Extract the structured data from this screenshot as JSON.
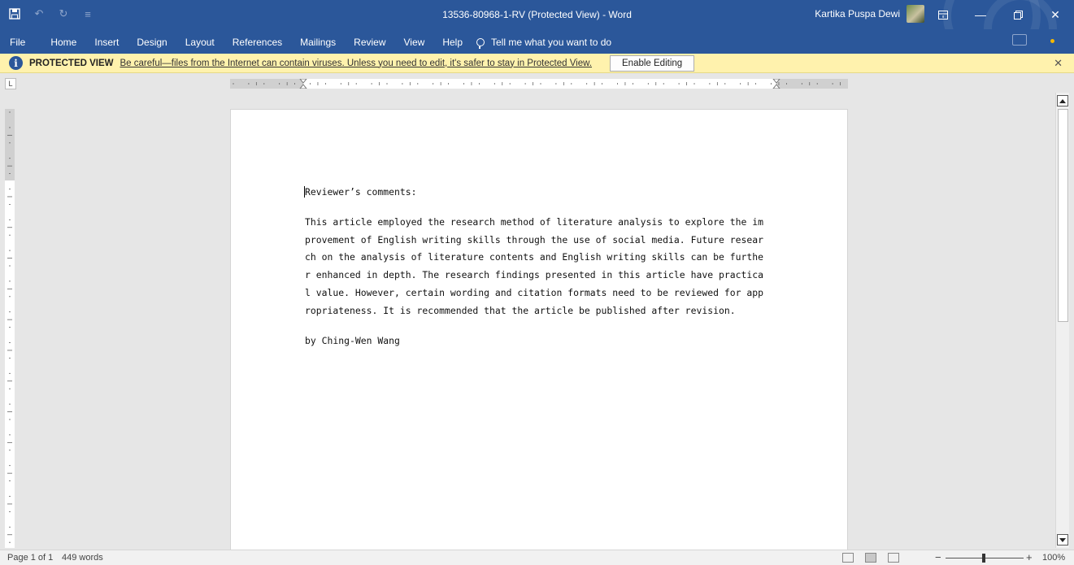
{
  "window": {
    "title": "13536-80968-1-RV (Protected View)  -  Word",
    "user_name": "Kartika Puspa Dewi"
  },
  "quick_access": {
    "icons": [
      "save-icon",
      "undo-icon",
      "redo-icon",
      "customize-icon"
    ]
  },
  "menu": {
    "tabs": [
      "File",
      "Home",
      "Insert",
      "Design",
      "Layout",
      "References",
      "Mailings",
      "Review",
      "View",
      "Help"
    ],
    "tell_me": "Tell me what you want to do"
  },
  "protected_view": {
    "title": "PROTECTED VIEW",
    "message": "Be careful—files from the Internet can contain viruses. Unless you need to edit, it's safer to stay in Protected View.",
    "button": "Enable Editing"
  },
  "ruler": {
    "corner": "L"
  },
  "document": {
    "heading": "Reviewer’s comments:",
    "body_lines": [
      "This article employed the research method of literature analysis to explore the im",
      "provement of English writing skills through the use of social media. Future resear",
      "ch on the analysis of literature contents and English writing skills can be furthe",
      "r enhanced in depth. The research findings presented in this article have practica",
      "l value. However, certain wording and citation formats need to be reviewed for app",
      "ropriateness. It is recommended that the article be published after revision."
    ],
    "byline": "by Ching-Wen Wang"
  },
  "status": {
    "page": "Page 1 of 1",
    "words": "449 words",
    "zoom": "100%",
    "zoom_level": 1.0
  },
  "colors": {
    "accent": "#2b579a",
    "protected_bar": "#fff2ad"
  }
}
